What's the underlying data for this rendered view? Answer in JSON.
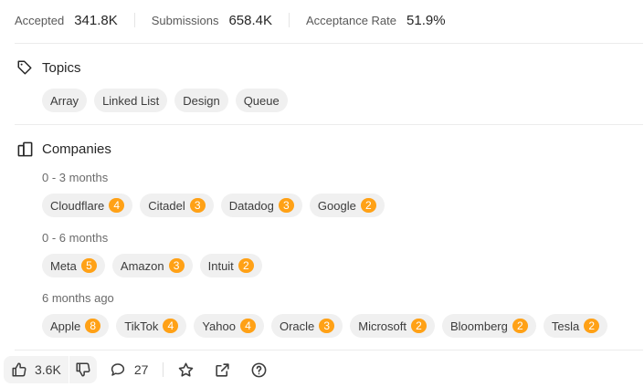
{
  "stats": [
    {
      "label": "Accepted",
      "value": "341.8K"
    },
    {
      "label": "Submissions",
      "value": "658.4K"
    },
    {
      "label": "Acceptance Rate",
      "value": "51.9%"
    }
  ],
  "topics": {
    "title": "Topics",
    "icon": "tag-icon",
    "items": [
      "Array",
      "Linked List",
      "Design",
      "Queue"
    ]
  },
  "companies": {
    "title": "Companies",
    "icon": "building-icon",
    "groups": [
      {
        "label": "0 - 3 months",
        "items": [
          {
            "name": "Cloudflare",
            "count": "4"
          },
          {
            "name": "Citadel",
            "count": "3"
          },
          {
            "name": "Datadog",
            "count": "3"
          },
          {
            "name": "Google",
            "count": "2"
          }
        ]
      },
      {
        "label": "0 - 6 months",
        "items": [
          {
            "name": "Meta",
            "count": "5"
          },
          {
            "name": "Amazon",
            "count": "3"
          },
          {
            "name": "Intuit",
            "count": "2"
          }
        ]
      },
      {
        "label": "6 months ago",
        "items": [
          {
            "name": "Apple",
            "count": "8"
          },
          {
            "name": "TikTok",
            "count": "4"
          },
          {
            "name": "Yahoo",
            "count": "4"
          },
          {
            "name": "Oracle",
            "count": "3"
          },
          {
            "name": "Microsoft",
            "count": "2"
          },
          {
            "name": "Bloomberg",
            "count": "2"
          },
          {
            "name": "Tesla",
            "count": "2"
          }
        ]
      }
    ]
  },
  "footer": {
    "likes": "3.6K",
    "comments": "27"
  },
  "colors": {
    "badge": "#ffa116",
    "chip_bg": "#f0f0f0"
  }
}
